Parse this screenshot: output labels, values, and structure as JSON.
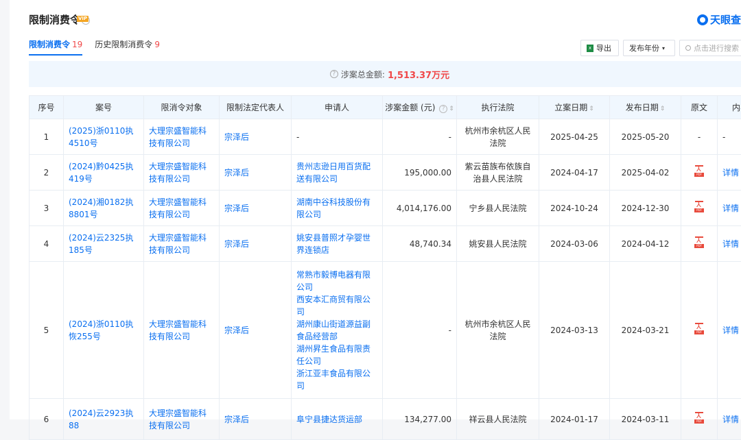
{
  "header": {
    "title": "限制消费令",
    "vip_badge": "VIP",
    "help_icon": "question-circle-icon",
    "brand_name": "天眼查"
  },
  "tabs": [
    {
      "label": "限制消费令",
      "count": "19"
    },
    {
      "label": "历史限制消费令",
      "count": "9"
    }
  ],
  "toolbar": {
    "export_label": "导出",
    "year_label": "发布年份",
    "search_placeholder": "点击进行搜索"
  },
  "summary": {
    "label": "涉案总金额:",
    "amount": "1,513.37万元"
  },
  "table": {
    "headers": [
      "序号",
      "案号",
      "限消令对象",
      "限制法定代表人",
      "申请人",
      "涉案金额 (元)",
      "执行法院",
      "立案日期",
      "发布日期",
      "原文",
      "内容"
    ],
    "rows": [
      {
        "no": "1",
        "case": "(2025)浙0110执4510号",
        "target": "大理宗盛智能科技有限公司",
        "rep": "宗泽后",
        "applicant": "-",
        "applicant_link": false,
        "amount": "-",
        "court": "杭州市余杭区人民法院",
        "filed": "2025-04-25",
        "published": "2025-05-20",
        "doc": "-",
        "detail": "-"
      },
      {
        "no": "2",
        "case": "(2024)黔0425执419号",
        "target": "大理宗盛智能科技有限公司",
        "rep": "宗泽后",
        "applicant": "贵州志逊日用百货配送有限公司",
        "applicant_link": true,
        "amount": "195,000.00",
        "court": "紫云苗族布依族自治县人民法院",
        "filed": "2024-04-17",
        "published": "2025-04-02",
        "doc": "pdf",
        "detail": "详情"
      },
      {
        "no": "3",
        "case": "(2024)湘0182执8801号",
        "target": "大理宗盛智能科技有限公司",
        "rep": "宗泽后",
        "applicant": "湖南中谷科技股份有限公司",
        "applicant_link": true,
        "amount": "4,014,176.00",
        "court": "宁乡县人民法院",
        "filed": "2024-10-24",
        "published": "2024-12-30",
        "doc": "pdf",
        "detail": "详情"
      },
      {
        "no": "4",
        "case": "(2024)云2325执185号",
        "target": "大理宗盛智能科技有限公司",
        "rep": "宗泽后",
        "applicant": "姚安县普照才孕婴世界连锁店",
        "applicant_link": true,
        "amount": "48,740.34",
        "court": "姚安县人民法院",
        "filed": "2024-03-06",
        "published": "2024-04-12",
        "doc": "pdf",
        "detail": "详情"
      },
      {
        "no": "5",
        "case": "(2024)浙0110执恢255号",
        "target": "大理宗盛智能科技有限公司",
        "rep": "宗泽后",
        "applicant": "常熟市毅博电器有限公司\n西安本汇商贸有限公司\n湖州康山街道源益副食品经营部\n湖州昇生食品有限责任公司\n浙江亚丰食品有限公司",
        "applicant_link": true,
        "amount": "-",
        "court": "杭州市余杭区人民法院",
        "filed": "2024-03-13",
        "published": "2024-03-21",
        "doc": "pdf",
        "detail": "详情"
      },
      {
        "no": "6",
        "case": "(2024)云2923执88",
        "target": "大理宗盛智能科技有限公司",
        "rep": "宗泽后",
        "applicant": "阜宁县捷达货运部",
        "applicant_link": true,
        "amount": "134,277.00",
        "court": "祥云县人民法院",
        "filed": "2024-01-17",
        "published": "2024-03-11",
        "doc": "pdf",
        "detail": "详情"
      }
    ]
  }
}
